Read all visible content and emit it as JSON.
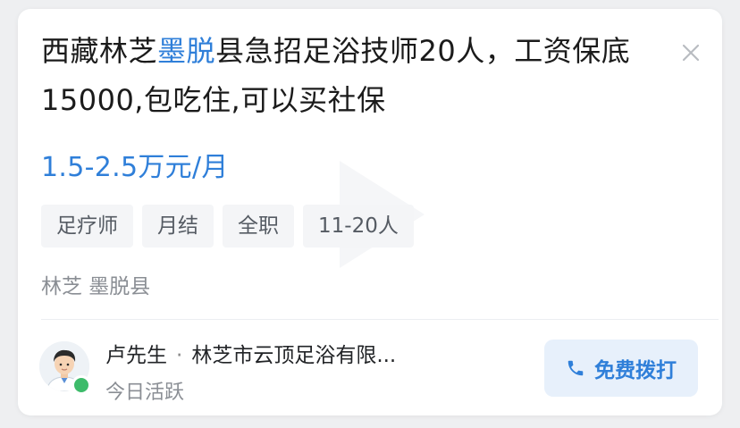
{
  "job": {
    "title_prefix": "西藏林芝",
    "title_highlight": "墨脱",
    "title_suffix": "县急招足浴技师20人，工资保底15000,包吃住,可以买社保",
    "salary": "1.5-2.5万元/月",
    "tags": [
      "足疗师",
      "月结",
      "全职",
      "11-20人"
    ],
    "location": "林芝  墨脱县"
  },
  "contact": {
    "name": "卢先生",
    "separator": "·",
    "company": "林芝市云顶足浴有限...",
    "status": "今日活跃",
    "call_label": "免费拨打"
  },
  "colors": {
    "accent": "#2f7fd9",
    "online": "#3dbb6a"
  },
  "icons": {
    "close": "close-icon",
    "phone": "phone-icon",
    "avatar": "user-avatar"
  }
}
